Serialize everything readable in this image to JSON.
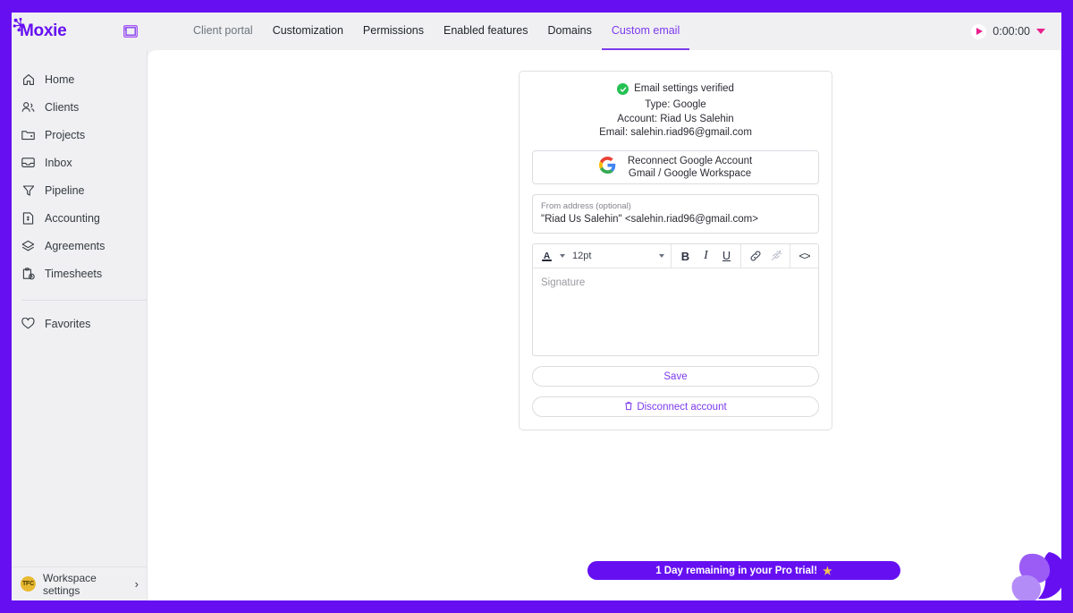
{
  "brand": {
    "logo_text": "oxie",
    "accent": "#6610f2",
    "tab_accent": "#7c3aed"
  },
  "topbar": {
    "panel_toggle_icon": "sidebar-toggle-icon",
    "tabs": [
      {
        "label": "Client portal",
        "active": false
      },
      {
        "label": "Customization",
        "active": false
      },
      {
        "label": "Permissions",
        "active": false
      },
      {
        "label": "Enabled features",
        "active": false
      },
      {
        "label": "Domains",
        "active": false
      },
      {
        "label": "Custom email",
        "active": true
      }
    ],
    "timer": {
      "play_icon": "play-icon",
      "value": "0:00:00",
      "caret_icon": "chevron-down-icon"
    }
  },
  "sidebar": {
    "items": [
      {
        "label": "Home",
        "icon": "home-icon"
      },
      {
        "label": "Clients",
        "icon": "users-icon"
      },
      {
        "label": "Projects",
        "icon": "folder-icon"
      },
      {
        "label": "Inbox",
        "icon": "inbox-icon"
      },
      {
        "label": "Pipeline",
        "icon": "funnel-icon"
      },
      {
        "label": "Accounting",
        "icon": "document-icon"
      },
      {
        "label": "Agreements",
        "icon": "agreements-icon"
      },
      {
        "label": "Timesheets",
        "icon": "clipboard-clock-icon"
      }
    ],
    "favorites": {
      "label": "Favorites",
      "icon": "heart-icon"
    },
    "workspace": {
      "avatar_text": "TFC",
      "avatar_color": "#e8b931",
      "label": "Workspace settings",
      "chevron": "›"
    }
  },
  "email_card": {
    "status": {
      "icon": "check-circle-icon",
      "color": "#25c152",
      "text": "Email settings verified"
    },
    "type_line": "Type: Google",
    "account_line": "Account: Riad Us Salehin",
    "email_line": "Email: salehin.riad96@gmail.com",
    "google_button": {
      "icon": "google-g-icon",
      "line1": "Reconnect Google Account",
      "line2": "Gmail / Google Workspace"
    },
    "from_address": {
      "label": "From address (optional)",
      "value": "\"Riad Us Salehin\" <salehin.riad96@gmail.com>"
    },
    "editor": {
      "toolbar": {
        "text_color_icon": "text-color-icon",
        "text_color_caret": "chevron-down-icon",
        "font_size": "12pt",
        "font_size_caret": "chevron-down-icon",
        "bold": "B",
        "italic": "I",
        "underline": "U",
        "link_icon": "link-icon",
        "unlink_icon": "unlink-icon",
        "code_icon": "<>"
      },
      "placeholder": "Signature",
      "value": ""
    },
    "save_label": "Save",
    "disconnect": {
      "icon": "trash-icon",
      "label": "Disconnect account"
    }
  },
  "trial_banner": {
    "text": "1 Day remaining in your Pro trial!",
    "star_icon": "star-icon",
    "background": "#6610f2"
  },
  "help_widget": {
    "icon": "help-widget-icon"
  }
}
